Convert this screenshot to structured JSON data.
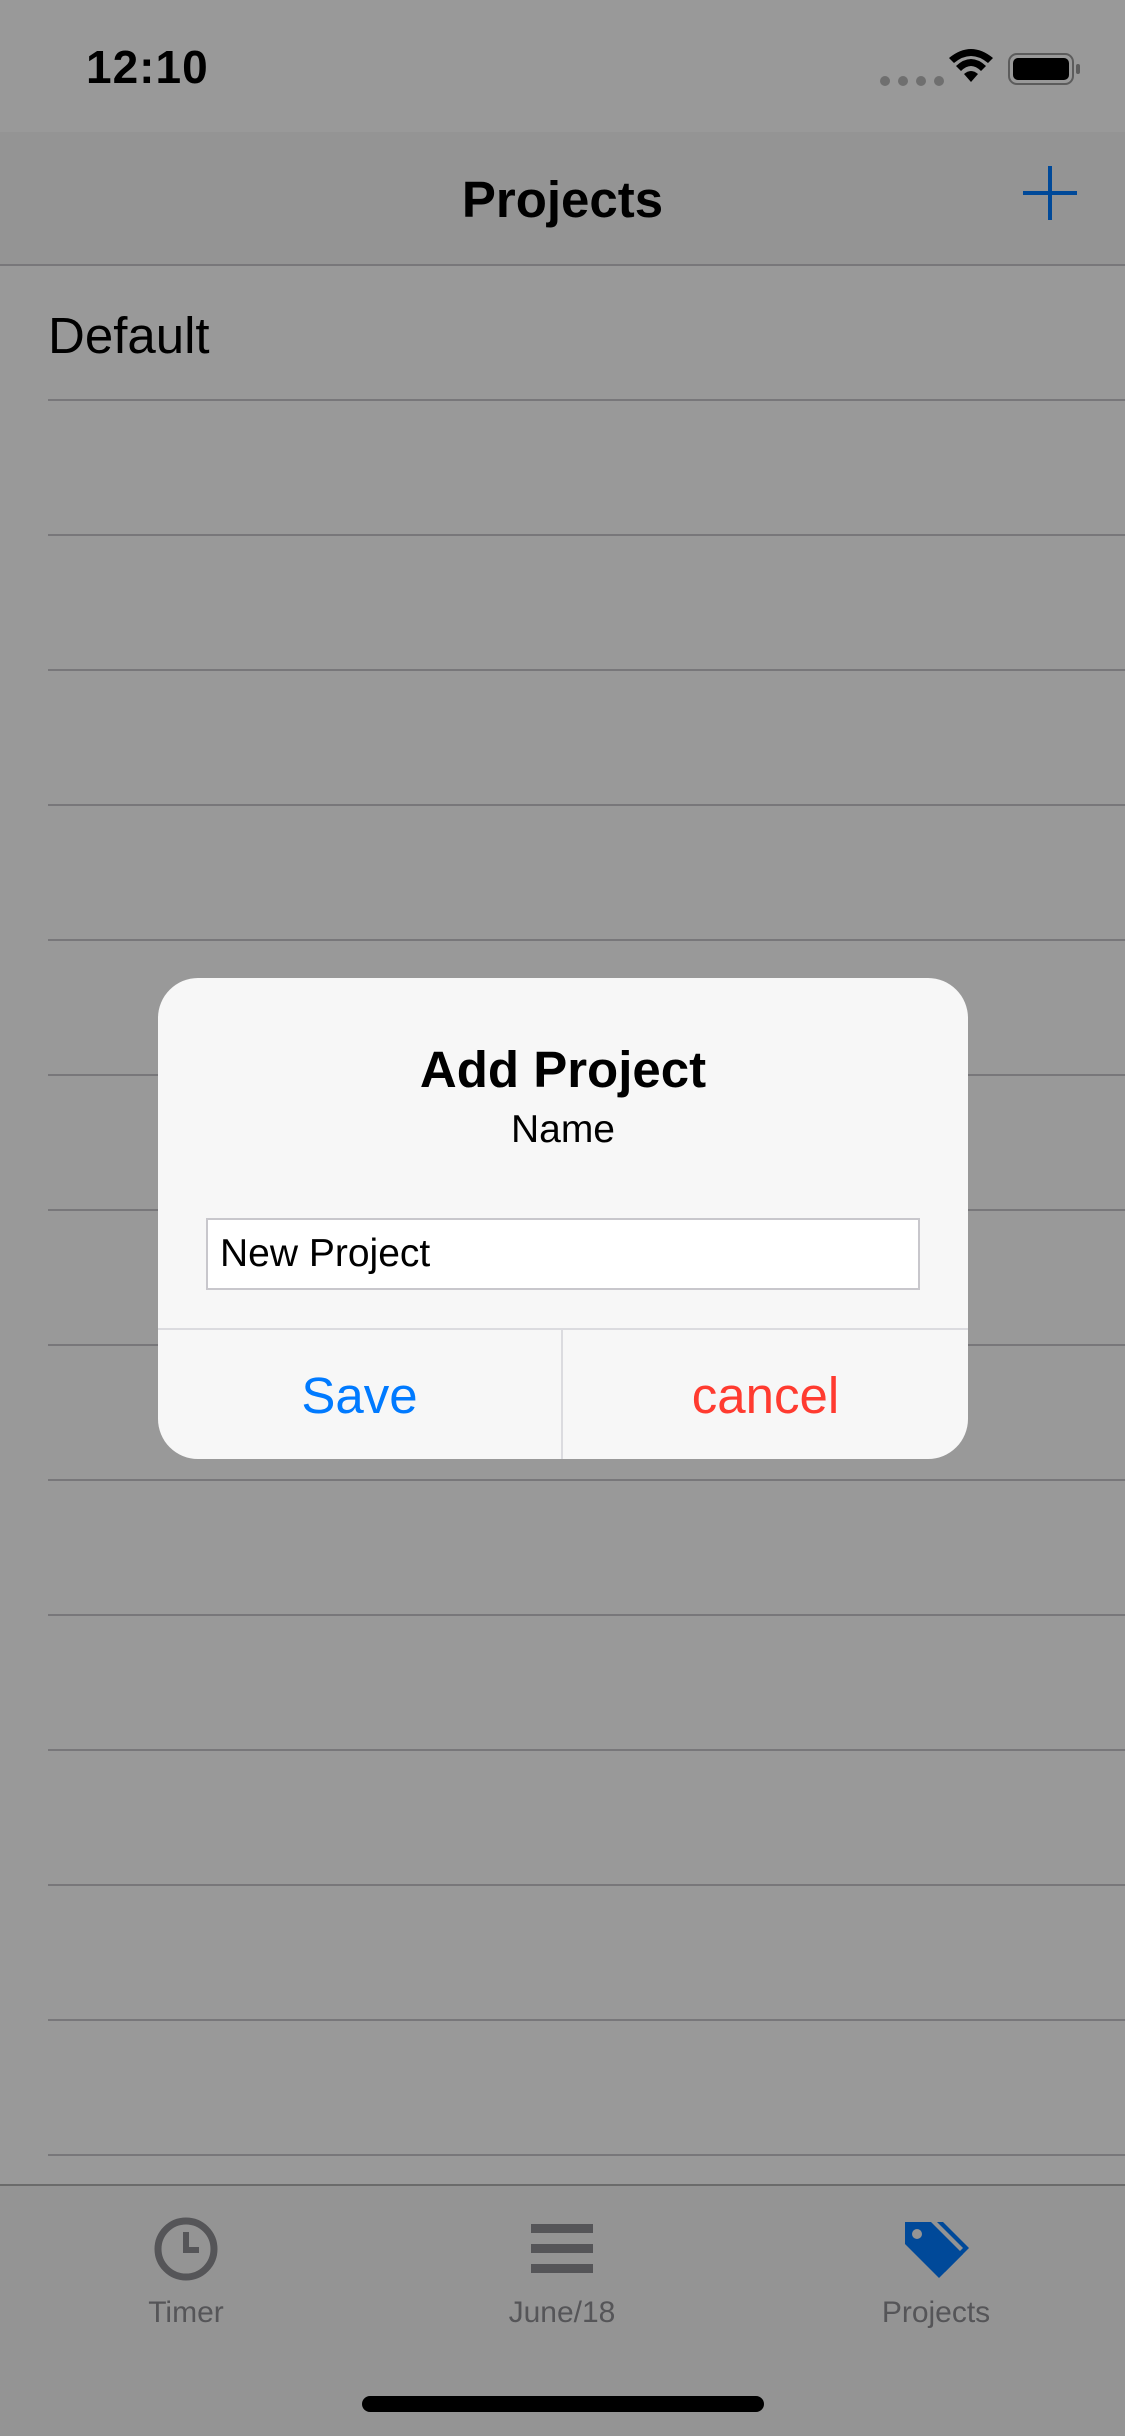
{
  "status_bar": {
    "time": "12:10"
  },
  "nav": {
    "title": "Projects",
    "add_icon": "plus-icon"
  },
  "projects": [
    {
      "name": "Default"
    }
  ],
  "tabs": [
    {
      "label": "Timer",
      "icon": "clock-icon"
    },
    {
      "label": "June/18",
      "icon": "list-icon"
    },
    {
      "label": "Projects",
      "icon": "tags-icon"
    }
  ],
  "alert": {
    "title": "Add Project",
    "message": "Name",
    "input_value": "New Project",
    "save_label": "Save",
    "cancel_label": "cancel"
  },
  "colors": {
    "accent": "#007aff",
    "destructive": "#ff3b30",
    "overlay": "rgba(0,0,0,0.4)"
  }
}
